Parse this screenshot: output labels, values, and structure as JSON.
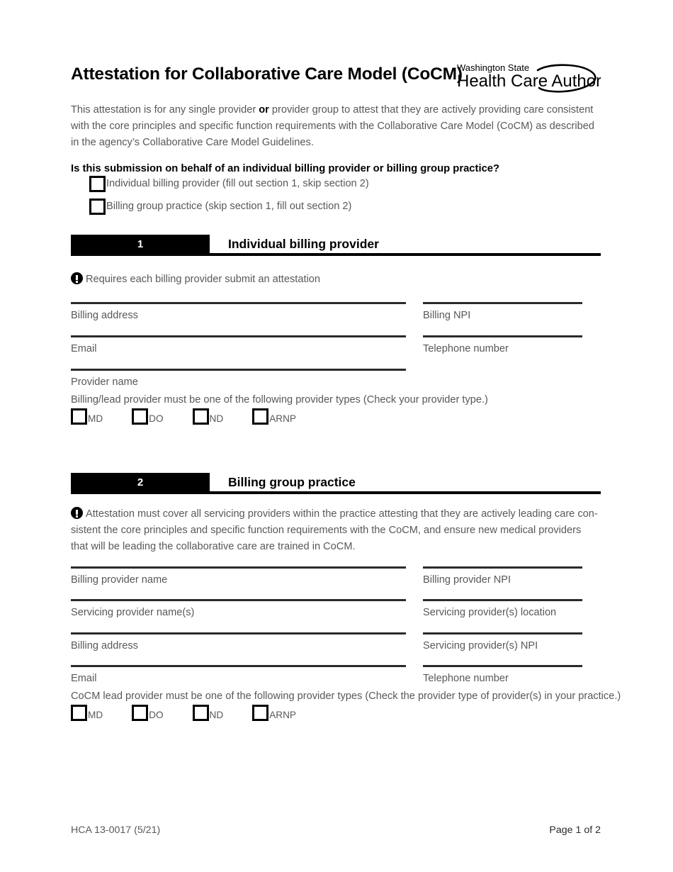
{
  "document": {
    "title": "Attestation for Collaborative Care Model (CoCM)",
    "logo": {
      "line1": "Washington State",
      "line2": "Health Care Authority",
      "name": "washington-state-health-care-authority-logo"
    },
    "intro": {
      "part1": "This attestation is for any single provider ",
      "bold": "or",
      "part2": " provider group to attest that they are actively providing care consistent with the core principles and specific function requirements with the Collaborative Care Model (CoCM) as described in the agency’s Collaborative Care Model Guidelines."
    },
    "question": "Is this submission on behalf of an individual billing provider or billing group practice?",
    "options": [
      {
        "label": "Individual billing provider (fill out section 1, skip section 2)",
        "checked": false
      },
      {
        "label": "Billing group practice (skip section 1, fill out section 2)",
        "checked": false
      }
    ]
  },
  "section1": {
    "number": "1",
    "title": "Individual billing provider",
    "note": "Requires each billing provider submit an attestation",
    "fields": [
      {
        "label": "Billing address",
        "value": "",
        "column": "left"
      },
      {
        "label": "Billing NPI",
        "value": "",
        "column": "right"
      },
      {
        "label": "Email",
        "value": "",
        "column": "left"
      },
      {
        "label": "Telephone number",
        "value": "",
        "column": "right"
      },
      {
        "label": "Provider name",
        "value": "",
        "column": "left"
      }
    ],
    "provider_type_text": "Billing/lead provider must be one of the following provider types (Check your provider type.)",
    "provider_types": [
      {
        "label": "MD",
        "checked": false
      },
      {
        "label": "DO",
        "checked": false
      },
      {
        "label": "ND",
        "checked": false
      },
      {
        "label": "ARNP",
        "checked": false
      }
    ]
  },
  "section2": {
    "number": "2",
    "title": "Billing group practice",
    "note": "Attestation must cover all servicing providers within the practice attesting that they are actively leading care con-sistent the core principles and specific function requirements with the CoCM, and ensure new medical providers that will be leading the collaborative care are trained in CoCM.",
    "fields": [
      {
        "label": "Billing provider name",
        "value": "",
        "column": "left"
      },
      {
        "label": "Billing provider NPI",
        "value": "",
        "column": "right"
      },
      {
        "label": "Servicing provider name(s)",
        "value": "",
        "column": "left"
      },
      {
        "label": "Servicing provider(s) location",
        "value": "",
        "column": "right"
      },
      {
        "label": "Billing address",
        "value": "",
        "column": "left"
      },
      {
        "label": "Servicing provider(s) NPI",
        "value": "",
        "column": "right"
      },
      {
        "label": "Email",
        "value": "",
        "column": "left"
      },
      {
        "label": "Telephone number",
        "value": "",
        "column": "right"
      }
    ],
    "provider_type_text": "CoCM lead provider must be one of the following provider types (Check the provider type of provider(s) in your practice.)",
    "provider_types": [
      {
        "label": "MD",
        "checked": false
      },
      {
        "label": "DO",
        "checked": false
      },
      {
        "label": "ND",
        "checked": false
      },
      {
        "label": "ARNP",
        "checked": false
      }
    ]
  },
  "footer": {
    "form_number": "HCA 13-0017 (5/21)",
    "page_indicator": "Page 1 of 2"
  }
}
